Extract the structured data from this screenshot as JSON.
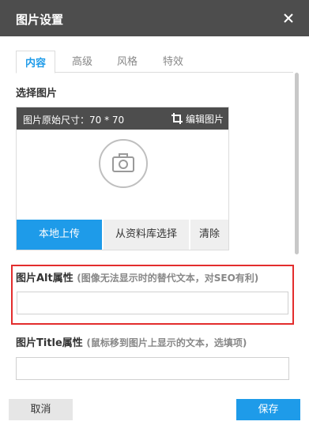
{
  "dialog": {
    "title": "图片设置",
    "close_icon": "close-icon"
  },
  "tabs": [
    {
      "label": "内容",
      "active": true
    },
    {
      "label": "高级",
      "active": false
    },
    {
      "label": "风格",
      "active": false
    },
    {
      "label": "特效",
      "active": false
    }
  ],
  "image_section": {
    "label": "选择图片",
    "original_size": "图片原始尺寸：70 * 70",
    "edit_label": "编辑图片",
    "edit_icon": "crop-icon",
    "placeholder_icon": "camera-icon",
    "upload_label": "本地上传",
    "library_label": "从资料库选择",
    "clear_label": "清除"
  },
  "alt_section": {
    "label": "图片Alt属性",
    "hint": "(图像无法显示时的替代文本，对SEO有利)",
    "value": "",
    "highlight_color": "#e32d2d"
  },
  "title_section": {
    "label": "图片Title属性",
    "hint": "(鼠标移到图片上显示的文本，选填项)",
    "value": ""
  },
  "footer": {
    "cancel_label": "取消",
    "save_label": "保存"
  },
  "colors": {
    "accent": "#1e9be9",
    "titlebar": "#4d4d4d"
  }
}
